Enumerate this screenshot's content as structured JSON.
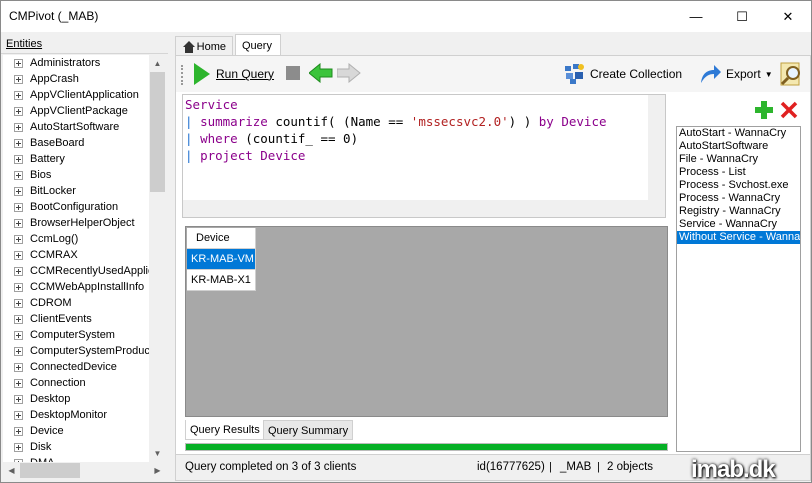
{
  "window": {
    "title": "CMPivot (_MAB)",
    "controls": {
      "minimize": "—",
      "maximize": "☐",
      "close": "✕"
    }
  },
  "entities": {
    "header": "Entities",
    "items": [
      "Administrators",
      "AppCrash",
      "AppVClientApplication",
      "AppVClientPackage",
      "AutoStartSoftware",
      "BaseBoard",
      "Battery",
      "Bios",
      "BitLocker",
      "BootConfiguration",
      "BrowserHelperObject",
      "CcmLog()",
      "CCMRAX",
      "CCMRecentlyUsedApplic",
      "CCMWebAppInstallInfo",
      "CDROM",
      "ClientEvents",
      "ComputerSystem",
      "ComputerSystemProduct",
      "ConnectedDevice",
      "Connection",
      "Desktop",
      "DesktopMonitor",
      "Device",
      "Disk",
      "DMA"
    ]
  },
  "tabs": [
    {
      "label": "Home"
    },
    {
      "label": "Query"
    }
  ],
  "toolbar": {
    "run_label": "Run Query",
    "create_collection_label": "Create Collection",
    "export_label": "Export"
  },
  "query": {
    "line1": "Service",
    "line2_kw1": "summarize",
    "line2_a": " countif( (Name == ",
    "line2_str": "'mssecsvc2.0'",
    "line2_b": ") ) ",
    "line2_kw2": "by",
    "line2_c": " ",
    "line2_kw3": "Device",
    "line3_kw1": "where",
    "line3_a": " (countif_ == 0)",
    "line4_kw1": "project",
    "line4_a": " ",
    "line4_kw2": "Device",
    "pipe": "|"
  },
  "saved_queries": {
    "items": [
      "AutoStart - WannaCry",
      "AutoStartSoftware",
      "File - WannaCry",
      "Process - List",
      "Process - Svchost.exe",
      "Process - WannaCry",
      "Registry - WannaCry",
      "Service - WannaCry",
      "Without Service - WannaCry"
    ],
    "selected_index": 8
  },
  "results": {
    "column": "Device",
    "rows": [
      "KR-MAB-VM",
      "KR-MAB-X1"
    ],
    "selected_index": 0
  },
  "result_tabs": {
    "results_label": "Query Results",
    "summary_label": "Query Summary"
  },
  "progress": {
    "fraction": 1.0
  },
  "status": {
    "message": "Query completed on 3 of 3 clients",
    "id": "id(16777625)",
    "separator": "|",
    "site": "_MAB",
    "count": "2 objects"
  },
  "watermark": "imab.dk",
  "colors": {
    "accent": "#0078d7",
    "keyword": "#8b008b",
    "string": "#b22222",
    "pipe": "#2070d0",
    "run_green": "#2db52d",
    "progress_green": "#06b025"
  }
}
